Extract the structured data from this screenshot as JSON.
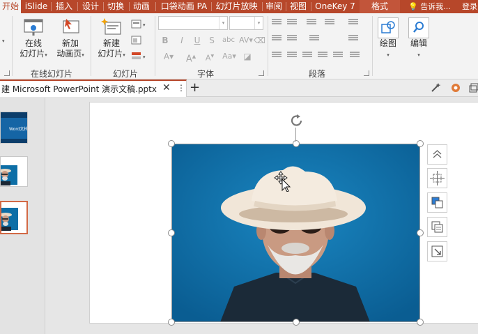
{
  "tabs": [
    {
      "label": "开始",
      "active": true
    },
    {
      "label": "iSlide"
    },
    {
      "label": "插入"
    },
    {
      "label": "设计"
    },
    {
      "label": "切换"
    },
    {
      "label": "动画"
    },
    {
      "label": "口袋动画 PA"
    },
    {
      "label": "幻灯片放映"
    },
    {
      "label": "审阅"
    },
    {
      "label": "视图"
    },
    {
      "label": "OneKey 7"
    },
    {
      "label": "格式"
    }
  ],
  "tell_me": "告诉我...",
  "login": "登录",
  "ribbon": {
    "online_slides": {
      "button_label_1": "在线",
      "button_label_2": "幻灯片",
      "group_label": "在线幻灯片"
    },
    "slides": {
      "new_anim_label_1": "新加",
      "new_anim_label_2": "动画页",
      "new_slide_label_1": "新建",
      "new_slide_label_2": "幻灯片",
      "group_label": "幻灯片"
    },
    "font": {
      "font_name": "",
      "font_size": "",
      "bold": "B",
      "italic": "I",
      "underline": "U",
      "strike": "S",
      "group_label": "字体"
    },
    "paragraph": {
      "group_label": "段落"
    },
    "drawing": {
      "label": "绘图"
    },
    "editing": {
      "label": "编辑"
    }
  },
  "document": {
    "title": "建 Microsoft PowerPoint 演示文稿.pptx"
  },
  "thumbnails": [
    {
      "number": "",
      "caption": "Word文档"
    },
    {
      "number": ""
    },
    {
      "number": "",
      "selected": true
    }
  ],
  "colors": {
    "accent": "#b7472a",
    "photo_bg": "#0d6ea6"
  }
}
